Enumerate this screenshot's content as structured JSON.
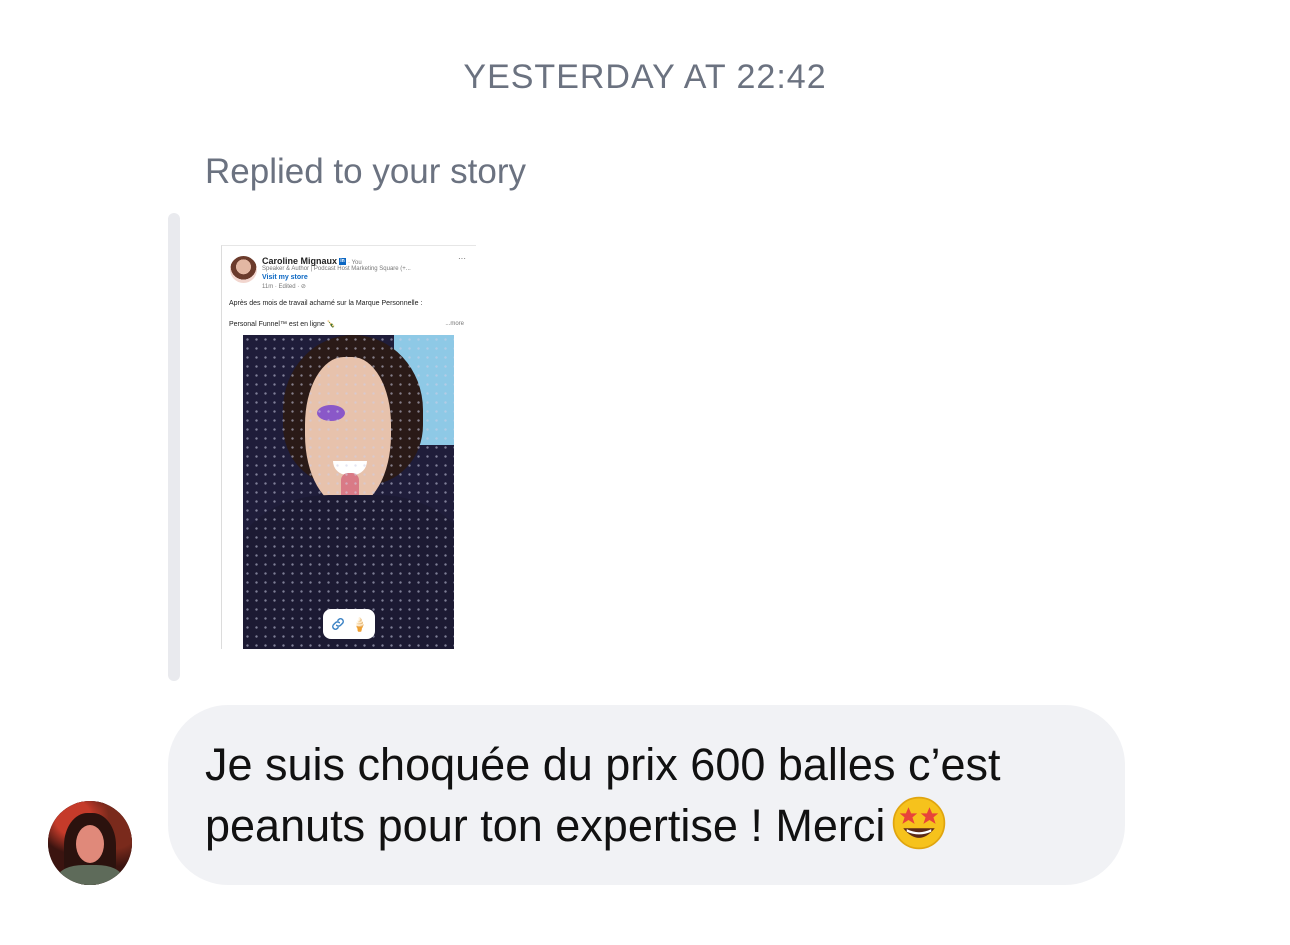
{
  "timestamp": "YESTERDAY AT 22:42",
  "reply_label": "Replied to your story",
  "story": {
    "author_name": "Caroline Mignaux",
    "you_label": "· You",
    "more_menu": "···",
    "subtitle": "Speaker & Author | Podcast Host Marketing Square (+...",
    "visit_store": "Visit my store",
    "meta": "11m · Edited · ⊘",
    "text_line1": "Après des mois de travail acharné sur la Marque Personnelle :",
    "text_line2": "Personal Funnel™ est en ligne 🍾",
    "see_more": "...more",
    "link_icon": "link-icon",
    "sticker_icon": "ice-cream-icon"
  },
  "message": {
    "text": "Je suis choquée du prix 600 balles c’est peanuts pour ton expertise ! Merci",
    "emoji": "star-struck-emoji"
  },
  "colors": {
    "bubble": "#f1f2f5",
    "muted_text": "#6b7280",
    "linkedin_blue": "#0a66c2",
    "emoji_yellow": "#f6c21c"
  }
}
